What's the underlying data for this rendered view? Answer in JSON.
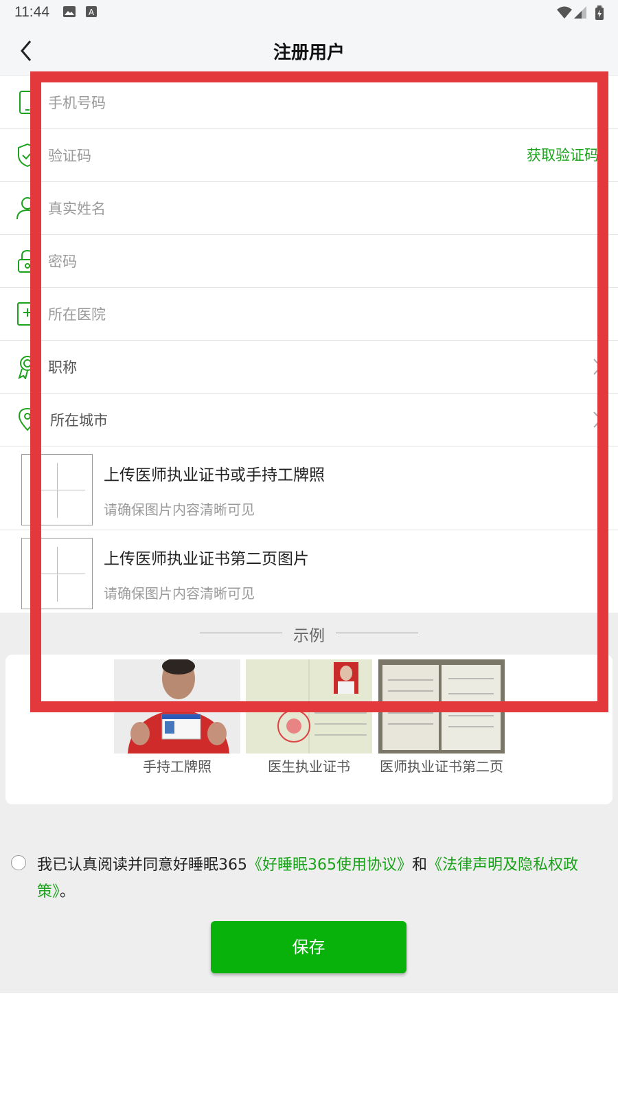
{
  "status_bar": {
    "time": "11:44"
  },
  "header": {
    "title": "注册用户"
  },
  "form": {
    "phone_placeholder": "手机号码",
    "code_placeholder": "验证码",
    "get_code": "获取验证码",
    "name_placeholder": "真实姓名",
    "password_placeholder": "密码",
    "hospital_placeholder": "所在医院",
    "title_label": "职称",
    "city_label": "所在城市"
  },
  "uploads": [
    {
      "title": "上传医师执业证书或手持工牌照",
      "hint": "请确保图片内容清晰可见"
    },
    {
      "title": "上传医师执业证书第二页图片",
      "hint": "请确保图片内容清晰可见"
    }
  ],
  "example": {
    "title": "示例",
    "captions": [
      "手持工牌照",
      "医生执业证书",
      "医师执业证书第二页"
    ]
  },
  "agreement": {
    "prefix": "我已认真阅读并同意好睡眠365",
    "link1": "《好睡眠365使用协议》",
    "middle": "和",
    "link2": "《法律声明及隐私权政策》",
    "suffix": "。"
  },
  "save_label": "保存",
  "colors": {
    "accent": "#09b20b",
    "link": "#1aa31a",
    "highlight": "#e3393c"
  }
}
